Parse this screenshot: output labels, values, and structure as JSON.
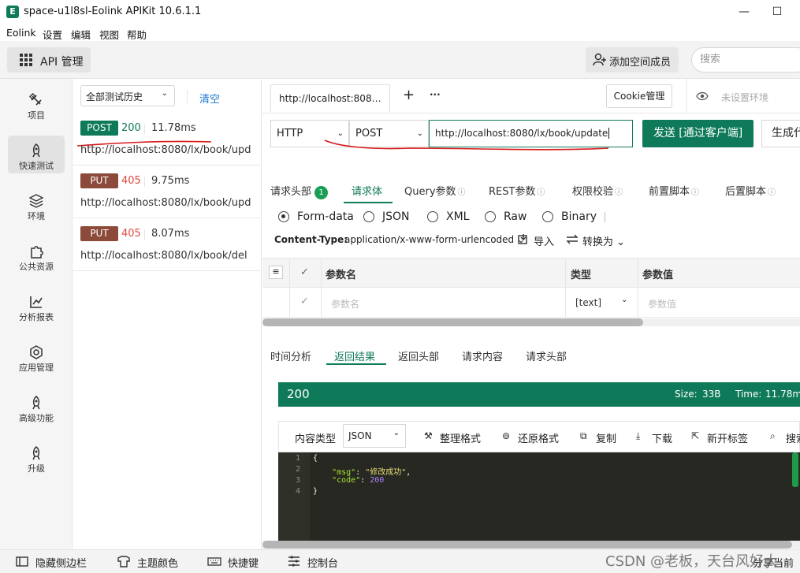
{
  "window": {
    "title": "space-u1l8sl-Eolink APIKit 10.6.1.1",
    "logo": "E"
  },
  "menu": [
    "Eolink",
    "设置",
    "编辑",
    "视图",
    "帮助"
  ],
  "toolbar": {
    "api_label": "API 管理",
    "add_member": "添加空间成员",
    "search_placeholder": "搜索"
  },
  "nav": [
    {
      "label": "项目",
      "icon": "project-icon"
    },
    {
      "label": "快速测试",
      "icon": "rocket-icon",
      "active": true
    },
    {
      "label": "环境",
      "icon": "environment-icon"
    },
    {
      "label": "公共资源",
      "icon": "puzzle-icon"
    },
    {
      "label": "分析报表",
      "icon": "chart-icon"
    },
    {
      "label": "应用管理",
      "icon": "gear-icon"
    },
    {
      "label": "高级功能",
      "icon": "rocket-icon"
    },
    {
      "label": "升级",
      "icon": "rocket-icon"
    }
  ],
  "history": {
    "filter": "全部测试历史",
    "clear": "清空",
    "items": [
      {
        "method": "POST",
        "status": "200",
        "time": "11.78ms",
        "url": "http://localhost:8080/lx/book/upd…",
        "color": "#0f7a5a",
        "status_color": "#0f7a5a"
      },
      {
        "method": "PUT",
        "status": "405",
        "time": "9.75ms",
        "url": "http://localhost:8080/lx/book/upd…",
        "color": "#8b4a3a",
        "status_color": "#e0483e"
      },
      {
        "method": "PUT",
        "status": "405",
        "time": "8.07ms",
        "url": "http://localhost:8080/lx/book/del",
        "color": "#8b4a3a",
        "status_color": "#e0483e"
      }
    ]
  },
  "tabs": {
    "current": "http://localhost:808…",
    "add": "+",
    "more": "···",
    "cookie": "Cookie管理",
    "env": "未设置环境"
  },
  "request": {
    "protocol": "HTTP",
    "method": "POST",
    "url": "http://localhost:8080/lx/book/update",
    "send": "发送 [通过客户端]",
    "gen_code": "生成代码",
    "tabs": [
      {
        "label": "请求头部",
        "badge": "1"
      },
      {
        "label": "请求体",
        "active": true
      },
      {
        "label": "Query参数"
      },
      {
        "label": "REST参数"
      },
      {
        "label": "权限校验"
      },
      {
        "label": "前置脚本"
      },
      {
        "label": "后置脚本"
      }
    ],
    "body_types": [
      "Form-data",
      "JSON",
      "XML",
      "Raw",
      "Binary"
    ],
    "content_type_label": "Content-Type:",
    "content_type": "application/x-www-form-urlencoded",
    "import": "导入",
    "convert": "转换为",
    "table": {
      "headers": [
        "参数名",
        "类型",
        "参数值"
      ],
      "row": {
        "name_placeholder": "参数名",
        "type": "[text]",
        "value_placeholder": "参数值"
      }
    }
  },
  "response": {
    "tabs": [
      "时间分析",
      "返回结果",
      "返回头部",
      "请求内容",
      "请求头部"
    ],
    "active_tab": "返回结果",
    "status": "200",
    "size_label": "Size:",
    "size": "33B",
    "time_label": "Time:",
    "time": "11.78ms",
    "content_type_label": "内容类型",
    "content_type": "JSON",
    "actions": [
      "整理格式",
      "还原格式",
      "复制",
      "下载",
      "新开标签",
      "搜索"
    ],
    "code_lines": [
      "{",
      "    \"msg\": \"修改成功\",",
      "    \"code\": 200",
      "}"
    ],
    "line_numbers": [
      "1",
      "2",
      "3",
      "4"
    ]
  },
  "footer": {
    "hide_sidebar": "隐藏侧边栏",
    "theme": "主题颜色",
    "shortcuts": "快捷键",
    "console": "控制台",
    "share": "分享当前"
  },
  "watermark": "CSDN @老板，天台风好大"
}
